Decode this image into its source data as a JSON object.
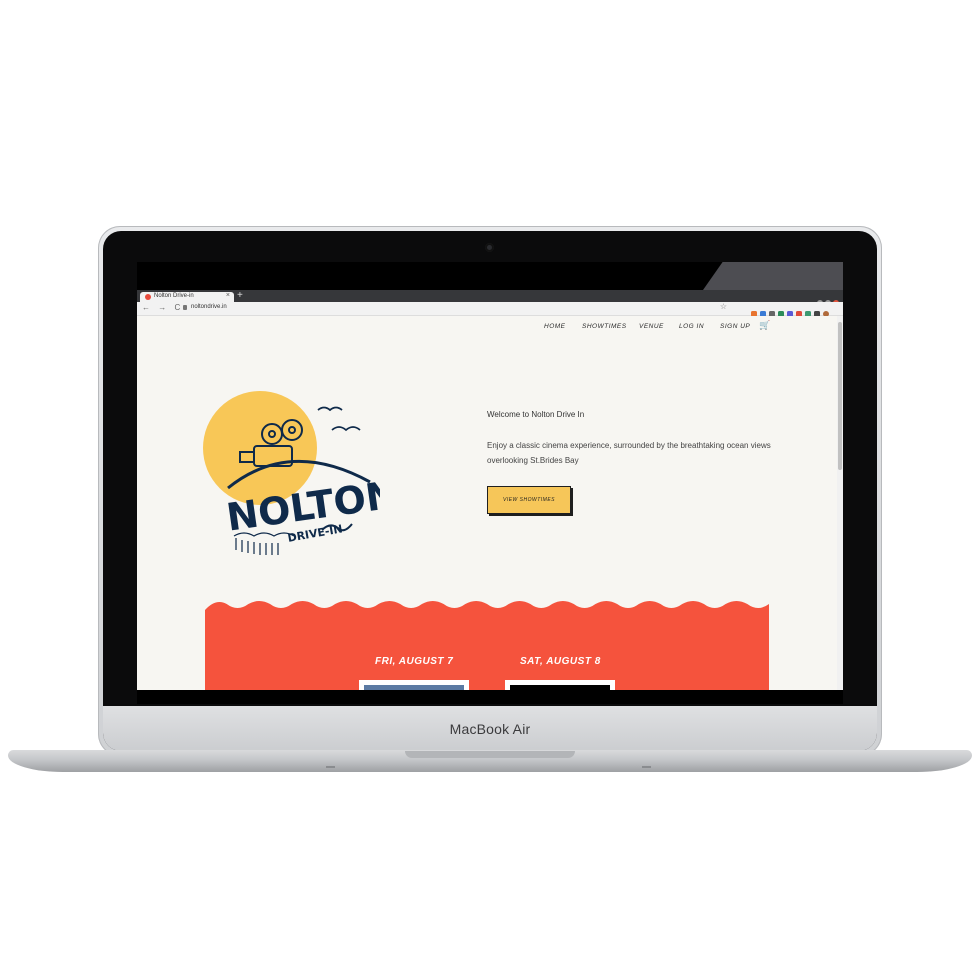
{
  "device": {
    "brand_label": "MacBook Air"
  },
  "browser": {
    "tab_title": "Nolton Drive-in",
    "tab_close": "×",
    "new_tab": "+",
    "nav_buttons": "← → C",
    "url": "noltondrive.in",
    "bookmark_star": "☆"
  },
  "site": {
    "nav": [
      "HOME",
      "SHOWTIMES",
      "VENUE",
      "LOG IN",
      "SIGN UP"
    ],
    "cart_icon": "🛒",
    "hero": {
      "welcome": "Welcome to Nolton Drive In",
      "description": "Enjoy a classic cinema experience, surrounded by the breathtaking ocean views overlooking St.Brides Bay",
      "cta_label": "VIEW SHOWTIMES"
    },
    "logo": {
      "word": "NOLTON",
      "sub": "DRIVE-IN"
    },
    "showtimes": {
      "days": [
        "FRI, AUGUST 7",
        "SAT, AUGUST 8"
      ]
    }
  },
  "colors": {
    "page_bg": "#f7f6f2",
    "sun": "#f8c757",
    "navy": "#0f2a4a",
    "coral": "#f5533d",
    "cta": "#f6c659"
  }
}
